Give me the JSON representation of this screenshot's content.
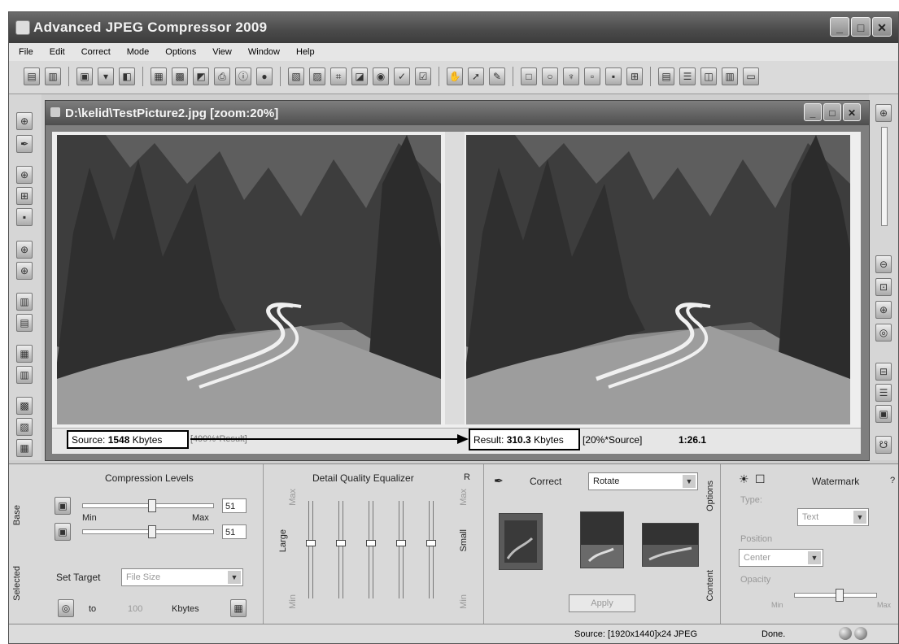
{
  "app": {
    "title": "Advanced JPEG Compressor 2009"
  },
  "menu": [
    "File",
    "Edit",
    "Correct",
    "Mode",
    "Options",
    "View",
    "Window",
    "Help"
  ],
  "document": {
    "title": "D:\\kelid\\TestPicture2.jpg  [zoom:20%]"
  },
  "status": {
    "source_label": "Source:",
    "source_size": "1548",
    "source_unit": "Kbytes",
    "source_extra": "[499%*Result]",
    "result_label": "Result:",
    "result_size": "310.3",
    "result_unit": "Kbytes",
    "result_extra": "[20%*Source]",
    "ratio": "1:26.1"
  },
  "compression": {
    "title": "Compression Levels",
    "min_label": "Min",
    "max_label": "Max",
    "value1": "51",
    "value2": "51",
    "set_target_label": "Set Target",
    "target_type": "File Size",
    "to_label": "to",
    "target_value": "100",
    "unit": "Kbytes",
    "tab_base": "Base",
    "tab_selected": "Selected"
  },
  "equalizer": {
    "title": "Detail Quality Equalizer",
    "large": "Large",
    "small": "Small",
    "max": "Max",
    "min": "Min",
    "r": "R"
  },
  "correct": {
    "label": "Correct",
    "selected": "Rotate",
    "apply": "Apply",
    "tab_options": "Options",
    "tab_content": "Content"
  },
  "watermark": {
    "title": "Watermark",
    "help": "?",
    "type_label": "Type:",
    "type_value": "Text",
    "position_label": "Position",
    "position_value": "Center",
    "opacity_label": "Opacity",
    "min": "Min",
    "max": "Max"
  },
  "bottom_status": {
    "source": "Source: [1920x1440]x24 JPEG",
    "done": "Done."
  }
}
